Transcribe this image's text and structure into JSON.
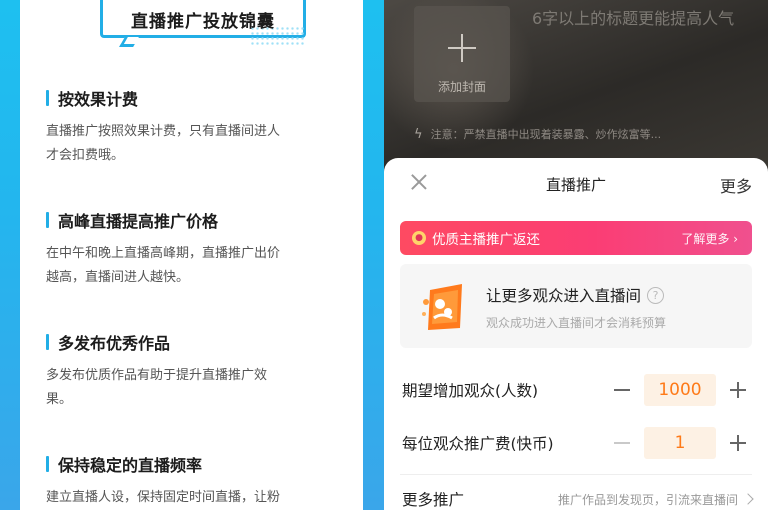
{
  "left": {
    "banner_title": "直播推广投放锦囊",
    "tips": [
      {
        "title": "按效果计费",
        "body": "直播推广按照效果计费，只有直播间进人\n才会扣费哦。"
      },
      {
        "title": "高峰直播提高推广价格",
        "body": "在中午和晚上直播高峰期，直播推广出价\n越高，直播间进人越快。"
      },
      {
        "title": "多发布优秀作品",
        "body": "多发布优质作品有助于提升直播推广效\n果。"
      },
      {
        "title": "保持稳定的直播频率",
        "body": "建立直播人设，保持固定时间直播，让粉"
      }
    ]
  },
  "phone": {
    "cover_label": "添加封面",
    "title_hint": "6字以上的标题更能提高人气",
    "notice": "注意：严禁直播中出现着装暴露、炒作炫富等...",
    "sheet": {
      "title": "直播推广",
      "more": "更多",
      "promo_text": "优质主播推广返还",
      "promo_link": "了解更多 ›",
      "card_title": "让更多观众进入直播间",
      "card_help": "?",
      "card_sub": "观众成功进入直播间才会消耗预算",
      "rows": [
        {
          "label": "期望增加观众(人数)",
          "value": "1000"
        },
        {
          "label": "每位观众推广费(快币)",
          "value": "1"
        }
      ],
      "more_promo_label": "更多推广",
      "more_promo_desc": "推广作品到发现页，引流来直播间"
    }
  },
  "colors": {
    "accent_blue": "#22aee6",
    "promo_red": "#fb3d74",
    "value_orange": "#fe7a18"
  }
}
